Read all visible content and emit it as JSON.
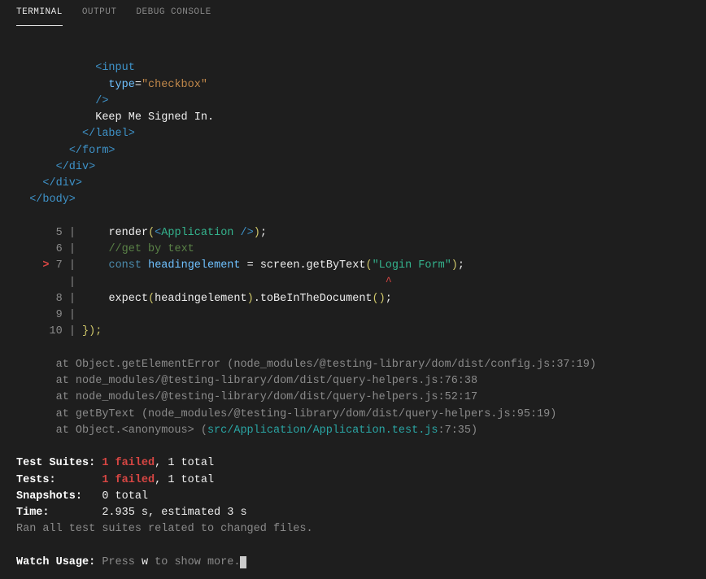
{
  "tabs": {
    "terminal": "TERMINAL",
    "output": "OUTPUT",
    "debug": "DEBUG CONSOLE"
  },
  "html_dump": {
    "input_open": "<input",
    "attr_type": "type",
    "attr_eq": "=",
    "attr_val": "\"checkbox\"",
    "input_close": "/>",
    "text_keep": "Keep Me Signed In.",
    "label_close": "</label>",
    "form_close": "</form>",
    "div_close1": "</div>",
    "div_close2": "</div>",
    "body_close": "</body>"
  },
  "code": {
    "l5_num": "5",
    "l5_render": "render",
    "l5_open": "(",
    "l5_tagopen": "<",
    "l5_app": "Application",
    "l5_tagclose": " />",
    "l5_close": ")",
    "l5_semi": ";",
    "l6_num": "6",
    "l6_comment": "//get by text",
    "marker": ">",
    "l7_num": "7",
    "l7_const": "const",
    "l7_var": "headingelement",
    "l7_eq": " = ",
    "l7_screen": "screen",
    "l7_dot": ".",
    "l7_get": "getByText",
    "l7_po": "(",
    "l7_str": "\"Login Form\"",
    "l7_pc": ")",
    "l7_semi": ";",
    "caret": "^",
    "l8_num": "8",
    "l8_expect": "expect",
    "l8_po": "(",
    "l8_var": "headingelement",
    "l8_pc": ")",
    "l8_dot": ".",
    "l8_tbd": "toBeInTheDocument",
    "l8_po2": "(",
    "l8_pc2": ")",
    "l8_semi": ";",
    "l9_num": "9",
    "l10_num": "10",
    "l10_close": "});"
  },
  "stack": {
    "s1_at": "at Object.getElementError ",
    "s1_path": "(node_modules/@testing-library/dom/dist/config.js:37:19)",
    "s2_at": "at ",
    "s2_path": "node_modules/@testing-library/dom/dist/query-helpers.js:76:38",
    "s3_at": "at ",
    "s3_path": "node_modules/@testing-library/dom/dist/query-helpers.js:52:17",
    "s4_at": "at getByText ",
    "s4_path": "(node_modules/@testing-library/dom/dist/query-helpers.js:95:19)",
    "s5_at": "at Object.<anonymous> (",
    "s5_src": "src/Application/Application.test.js",
    "s5_loc": ":7:35)"
  },
  "summary": {
    "suites_label": "Test Suites:",
    "suites_fail": "1 failed",
    "suites_rest": ", 1 total",
    "tests_label": "Tests:",
    "tests_fail": "1 failed",
    "tests_rest": ", 1 total",
    "snap_label": "Snapshots:",
    "snap_val": "0 total",
    "time_label": "Time:",
    "time_val": "2.935 s, estimated 3 s",
    "ran": "Ran all test suites related to changed files."
  },
  "watch": {
    "label": "Watch Usage:",
    "text1": " Press ",
    "key": "w",
    "text2": " to show more."
  }
}
